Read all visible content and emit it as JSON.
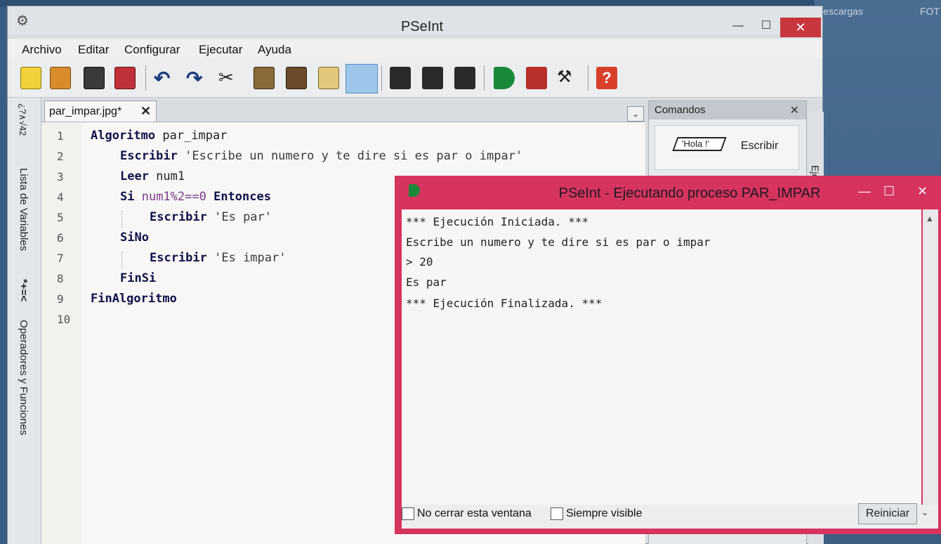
{
  "desktop": {
    "right_labels": [
      "Descargas",
      "FOT"
    ]
  },
  "main_window": {
    "title": "PSeInt",
    "controls": {
      "minimize": "—",
      "maximize": "☐",
      "close": "✕"
    },
    "menu": [
      "Archivo",
      "Editar",
      "Configurar",
      "Ejecutar",
      "Ayuda"
    ],
    "side_panel": {
      "variables_label": "Lista de Variables",
      "variables_icon": "*+=<",
      "operators_label": "Operadores y Funciones",
      "operators_icon_text": "¿?∧√42"
    },
    "tab": {
      "label": "par_impar.jpg*",
      "close": "✕"
    },
    "editor": {
      "line_numbers": [
        "1",
        "2",
        "3",
        "4",
        "5",
        "6",
        "7",
        "8",
        "9",
        "10"
      ],
      "lines": [
        {
          "kw": "Algoritmo",
          "rest": " par_impar"
        },
        {
          "kw": "Escribir",
          "rest": " 'Escribe un numero y te dire si es par o impar'"
        },
        {
          "kw": "Leer",
          "rest": " num1"
        },
        {
          "kw": "Si",
          "rest": " num1%2==0 ",
          "kw2": "Entonces"
        },
        {
          "kw": "Escribir",
          "rest": " 'Es par'"
        },
        {
          "kw": "SiNo",
          "rest": ""
        },
        {
          "kw": "Escribir",
          "rest": " 'Es impar'"
        },
        {
          "kw": "FinSi",
          "rest": ""
        },
        {
          "kw": "FinAlgoritmo",
          "rest": ""
        }
      ]
    },
    "comandos": {
      "title": "Comandos",
      "close": "✕",
      "item_hola": "'Hola !'",
      "item_label": "Escribir",
      "vertical_label": "Ejec"
    }
  },
  "exec_window": {
    "title": "PSeInt - Ejecutando proceso PAR_IMPAR",
    "controls": {
      "minimize": "—",
      "maximize": "☐",
      "close": "✕"
    },
    "console_lines": [
      "*** Ejecución Iniciada. ***",
      "Escribe un numero y te dire si es par o impar",
      "> 20",
      "Es par",
      "*** Ejecución Finalizada. ***"
    ],
    "no_cerrar_label": "No cerrar esta ventana",
    "siempre_visible_label": "Siempre visible",
    "reiniciar_label": "Reiniciar"
  },
  "toolbar_icons": [
    "new-file-icon",
    "open-file-icon",
    "save-icon",
    "save-as-icon",
    "undo-icon",
    "redo-icon",
    "cut-icon",
    "copy-icon",
    "paste-icon",
    "edit-icon",
    "find-icon",
    "indent-icon",
    "comment-icon",
    "uncomment-icon",
    "run-icon",
    "step-icon",
    "debug-icon",
    "help-icon"
  ]
}
